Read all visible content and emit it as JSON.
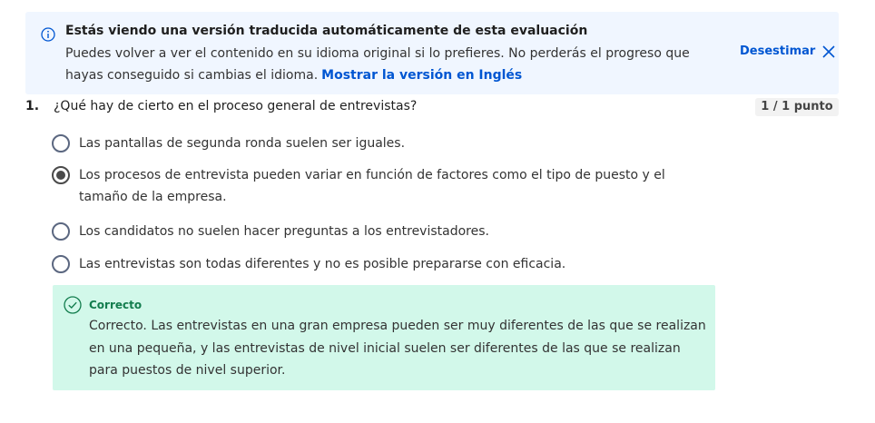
{
  "banner": {
    "title": "Estás viendo una versión traducida automáticamente de esta evaluación",
    "body": "Puedes volver a ver el contenido en su idioma original si lo prefieres. No perderás el progreso que hayas conseguido si cambias el idioma.",
    "link": "Mostrar la versión en Inglés",
    "dismiss": "Desestimar",
    "info_icon": "info-icon",
    "close_icon": "close-icon"
  },
  "question": {
    "number": "1.",
    "text": "¿Qué hay de cierto en el proceso general de entrevistas?",
    "points": "1 / 1 punto",
    "options": [
      {
        "label": "Las pantallas de segunda ronda suelen ser iguales.",
        "selected": false
      },
      {
        "label": "Los procesos de entrevista pueden variar en función de factores como el tipo de puesto y el tamaño de la empresa.",
        "selected": true
      },
      {
        "label": "Los candidatos no suelen hacer preguntas a los entrevistadores.",
        "selected": false
      },
      {
        "label": "Las entrevistas son todas diferentes y no es posible prepararse con eficacia.",
        "selected": false
      }
    ]
  },
  "feedback": {
    "title": "Correcto",
    "body": "Correcto. Las entrevistas en una gran empresa pueden ser muy diferentes de las que se realizan en una pequeña, y las entrevistas de nivel inicial suelen ser diferentes de las que se realizan para puestos de nivel superior.",
    "icon": "check-circle-icon"
  },
  "colors": {
    "link": "#0056d2",
    "banner_bg": "#f0f6ff",
    "feedback_bg": "#d2f8ea",
    "correct_text": "#137d4e"
  }
}
